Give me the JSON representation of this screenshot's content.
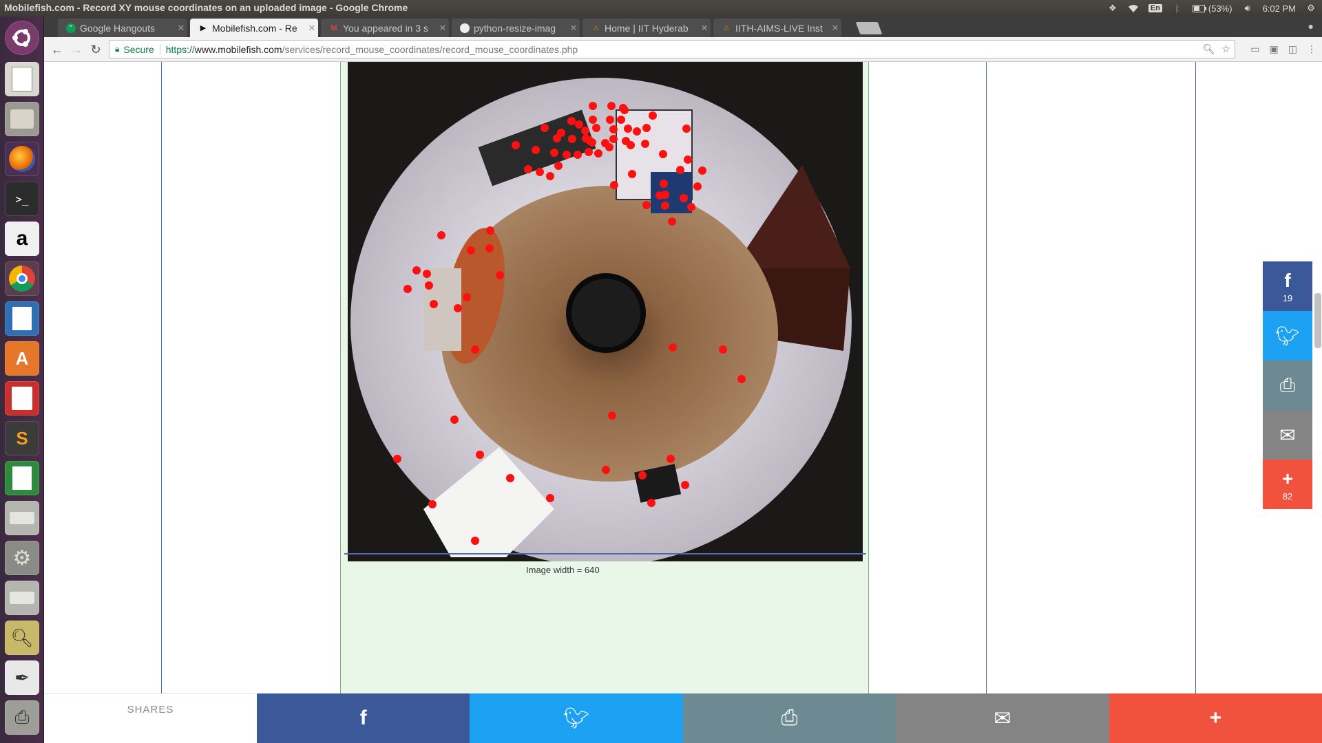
{
  "system": {
    "window_title": "Mobilefish.com - Record XY mouse coordinates on an uploaded image - Google Chrome",
    "keyboard_layout": "En",
    "battery": "(53%)",
    "clock": "6:02 PM",
    "tray_icons": [
      "dropbox-icon",
      "wifi-icon",
      "keyboard-icon",
      "bluetooth-icon",
      "battery-icon",
      "volume-icon",
      "gear-icon"
    ]
  },
  "launcher": {
    "items": [
      "ubuntu-logo-icon",
      "text-editor-icon",
      "file-manager-icon",
      "firefox-icon",
      "terminal-icon",
      "amazon-icon",
      "chrome-icon",
      "libreoffice-impress-icon",
      "software-center-icon",
      "document-viewer-icon",
      "sublime-text-icon",
      "libreoffice-calc-icon",
      "drive-icon",
      "system-settings-icon",
      "drive-icon-2",
      "image-viewer-icon",
      "inkscape-icon",
      "printer-icon"
    ]
  },
  "tabs": [
    {
      "title": "Google Hangouts",
      "favicon": "hangouts-icon",
      "active": false
    },
    {
      "title": "Mobilefish.com - Re",
      "favicon": "mobilefish-icon",
      "active": true
    },
    {
      "title": "You appeared in 3 s",
      "favicon": "gmail-icon",
      "active": false
    },
    {
      "title": "python-resize-imag",
      "favicon": "page-icon",
      "active": false
    },
    {
      "title": "Home | IIT Hyderab",
      "favicon": "iith-icon",
      "active": false
    },
    {
      "title": "IITH-AIMS-LIVE Inst",
      "favicon": "iith-icon",
      "active": false
    }
  ],
  "toolbar": {
    "secure_label": "Secure",
    "url_scheme": "https://",
    "url_host": "www.mobilefish.com",
    "url_path": "/services/record_mouse_coordinates/record_mouse_coordinates.php"
  },
  "page": {
    "caption": "Image width = 640"
  },
  "share_rail": {
    "facebook_count": "19",
    "plus_count": "82"
  },
  "share_bar": {
    "label": "SHARES"
  },
  "colors": {
    "facebook": "#3b5998",
    "twitter": "#1da1f2",
    "print": "#6d8a92",
    "email": "#848484",
    "plus": "#f0523e",
    "marker": "#ff1010"
  }
}
